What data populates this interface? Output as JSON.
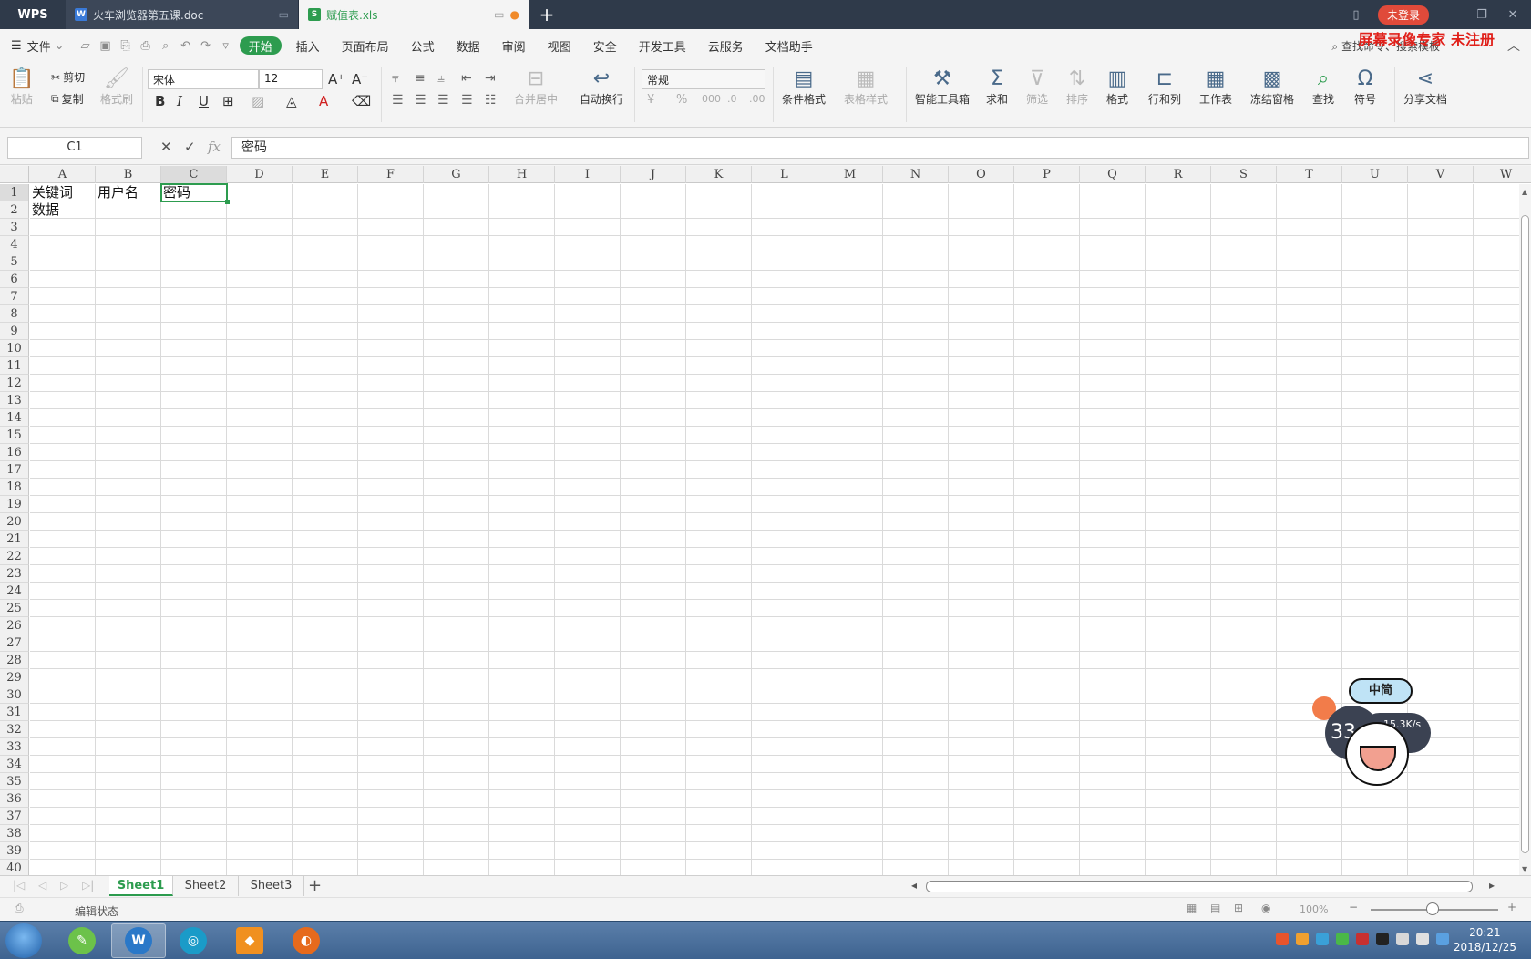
{
  "titlebar": {
    "app_name": "WPS",
    "tabs": [
      {
        "label": "火车浏览器第五课.doc",
        "type": "doc"
      },
      {
        "label": "赋值表.xls",
        "type": "xls"
      }
    ],
    "new_tab": "+",
    "login_label": "未登录"
  },
  "menu": {
    "file_label": "文件",
    "items": [
      "开始",
      "插入",
      "页面布局",
      "公式",
      "数据",
      "审阅",
      "视图",
      "安全",
      "开发工具",
      "云服务",
      "文档助手"
    ],
    "active_item": "开始",
    "search_placeholder": "查找命令、搜索模板",
    "watermark": "屏幕录像专家  未注册"
  },
  "ribbon": {
    "paste": "粘贴",
    "cut": "剪切",
    "copy": "复制",
    "format_painter": "格式刷",
    "font_name": "宋体",
    "font_size": "12",
    "bold": "B",
    "italic": "I",
    "underline": "U",
    "merge_center": "合并居中",
    "wrap_text": "自动换行",
    "number_format": "常规",
    "conditional_format": "条件格式",
    "table_style": "表格样式",
    "smart_toolbox": "智能工具箱",
    "sum": "求和",
    "filter": "筛选",
    "sort": "排序",
    "format": "格式",
    "row_col": "行和列",
    "worksheet": "工作表",
    "freeze": "冻结窗格",
    "find": "查找",
    "symbol": "符号",
    "share": "分享文档"
  },
  "formula_bar": {
    "name_box": "C1",
    "fx_label": "fx",
    "value": "密码"
  },
  "columns": [
    "A",
    "B",
    "C",
    "D",
    "E",
    "F",
    "G",
    "H",
    "I",
    "J",
    "K",
    "L",
    "M",
    "N",
    "O",
    "P",
    "Q",
    "R",
    "S",
    "T",
    "U",
    "V",
    "W"
  ],
  "selected_column": "C",
  "rows": [
    "1",
    "2",
    "3",
    "4",
    "5",
    "6",
    "7",
    "8",
    "9",
    "10",
    "11",
    "12",
    "13",
    "14",
    "15",
    "16",
    "17",
    "18",
    "19",
    "20",
    "21",
    "22",
    "23",
    "24",
    "25",
    "26",
    "27",
    "28",
    "29",
    "30",
    "31",
    "32",
    "33",
    "34",
    "35",
    "36",
    "37",
    "38",
    "39",
    "40"
  ],
  "cells": {
    "A1": "关键词",
    "B1": "用户名",
    "C1": "密码",
    "A2": "数据"
  },
  "sheets": [
    "Sheet1",
    "Sheet2",
    "Sheet3"
  ],
  "active_sheet": "Sheet1",
  "status": {
    "mode": "编辑状态",
    "zoom": "100%"
  },
  "mascot": {
    "bubble": "中简",
    "speed_big": "33",
    "speed_up": "15.3K/s",
    "speed_down": "K/s"
  },
  "taskbar": {
    "time": "20:21",
    "date": "2018/12/25"
  },
  "colors": {
    "accent": "#2d9c4f",
    "titlebar": "#2f3a4a",
    "login": "#e04a3a",
    "watermark": "#e0201a"
  }
}
